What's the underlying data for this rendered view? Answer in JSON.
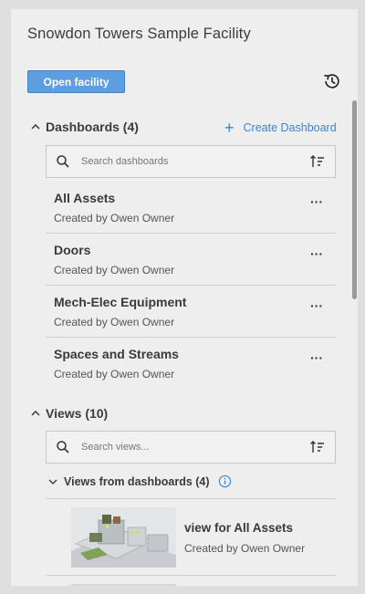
{
  "facility": {
    "title": "Snowdon Towers Sample Facility",
    "open_label": "Open facility"
  },
  "dashboards": {
    "header": "Dashboards (4)",
    "create_label": "Create Dashboard",
    "search_placeholder": "Search dashboards",
    "items": [
      {
        "name": "All Assets",
        "created_by": "Created by Owen Owner"
      },
      {
        "name": "Doors",
        "created_by": "Created by Owen Owner"
      },
      {
        "name": "Mech-Elec Equipment",
        "created_by": "Created by Owen Owner"
      },
      {
        "name": "Spaces and Streams",
        "created_by": "Created by Owen Owner"
      }
    ]
  },
  "views": {
    "header": "Views (10)",
    "search_placeholder": "Search views...",
    "group_label": "Views from dashboards (4)",
    "items": [
      {
        "name": "view for All Assets",
        "created_by": "Created by Owen Owner"
      }
    ]
  },
  "icons": {
    "history": "history-icon",
    "search": "search-icon",
    "sort": "sort-icon",
    "more": "more-icon",
    "info": "info-icon"
  },
  "colors": {
    "accent": "#3e85cc",
    "button": "#5d9ee0"
  }
}
